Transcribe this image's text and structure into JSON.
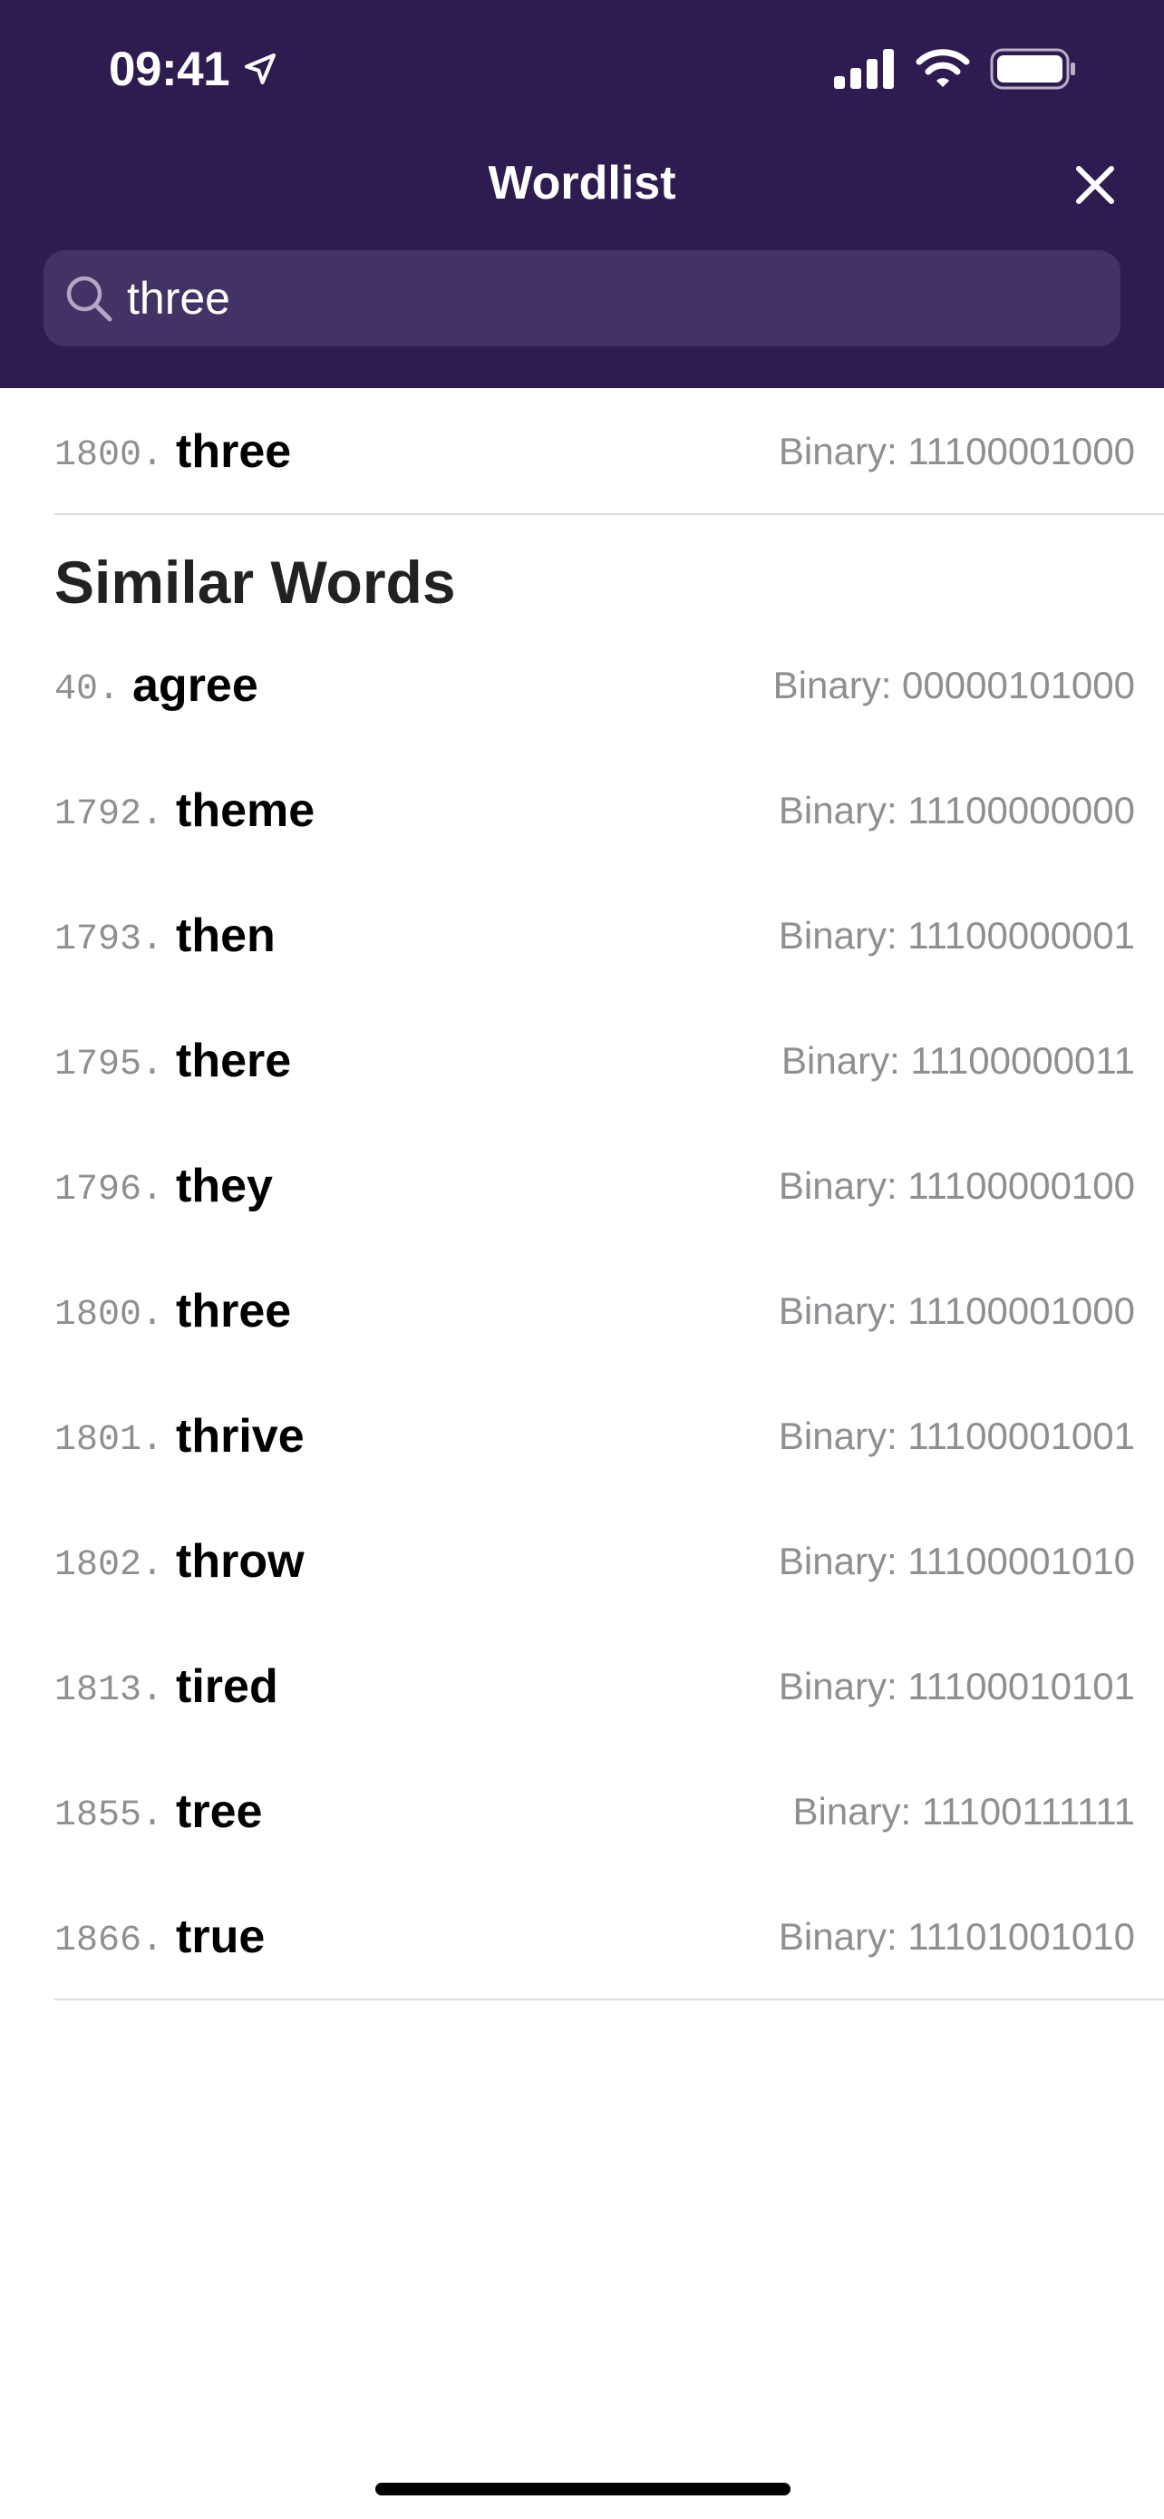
{
  "status_bar": {
    "time": "09:41"
  },
  "header": {
    "title": "Wordlist"
  },
  "search": {
    "value": "three",
    "placeholder": ""
  },
  "result": {
    "index": "1800.",
    "word": "three",
    "binary": "Binary: 11100001000"
  },
  "similar": {
    "title": "Similar Words",
    "items": [
      {
        "index": "40.",
        "word": "agree",
        "binary": "Binary: 00000101000"
      },
      {
        "index": "1792.",
        "word": "theme",
        "binary": "Binary: 11100000000"
      },
      {
        "index": "1793.",
        "word": "then",
        "binary": "Binary: 11100000001"
      },
      {
        "index": "1795.",
        "word": "there",
        "binary": "Binary: 11100000011"
      },
      {
        "index": "1796.",
        "word": "they",
        "binary": "Binary: 11100000100"
      },
      {
        "index": "1800.",
        "word": "three",
        "binary": "Binary: 11100001000"
      },
      {
        "index": "1801.",
        "word": "thrive",
        "binary": "Binary: 11100001001"
      },
      {
        "index": "1802.",
        "word": "throw",
        "binary": "Binary: 11100001010"
      },
      {
        "index": "1813.",
        "word": "tired",
        "binary": "Binary: 11100010101"
      },
      {
        "index": "1855.",
        "word": "tree",
        "binary": "Binary: 11100111111"
      },
      {
        "index": "1866.",
        "word": "true",
        "binary": "Binary: 11101001010"
      }
    ]
  },
  "colors": {
    "header_bg": "#2e1c50",
    "search_bg": "#433264",
    "secondary_text": "#8e8e93"
  }
}
